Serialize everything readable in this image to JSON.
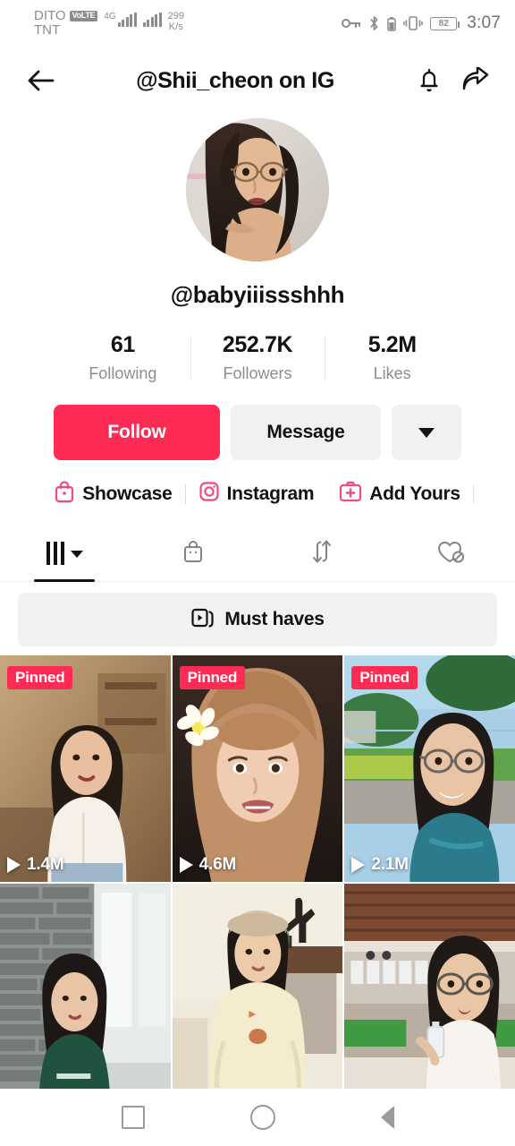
{
  "status_bar": {
    "carrier_primary": "DITO",
    "volte_badge": "VoLTE",
    "carrier_secondary": "TNT",
    "network_type": "4G",
    "net_speed_value": "299",
    "net_speed_unit": "K/s",
    "battery_percent": "82",
    "time": "3:07",
    "icons": [
      "key-icon",
      "bluetooth-icon",
      "vibrate-icon",
      "battery-icon"
    ]
  },
  "header": {
    "title": "@Shii_cheon on IG",
    "back_icon": "back-arrow-icon",
    "bell_icon": "bell-icon",
    "share_icon": "share-arrow-icon"
  },
  "profile": {
    "handle": "@babyiiissshhh",
    "avatar_alt": "profile-photo",
    "stats": [
      {
        "value": "61",
        "label": "Following"
      },
      {
        "value": "252.7K",
        "label": "Followers"
      },
      {
        "value": "5.2M",
        "label": "Likes"
      }
    ]
  },
  "actions": {
    "follow_label": "Follow",
    "message_label": "Message",
    "more_icon": "chevron-down-icon"
  },
  "links": [
    {
      "label": "Showcase",
      "icon": "shopping-bag-icon"
    },
    {
      "label": "Instagram",
      "icon": "instagram-icon"
    },
    {
      "label": "Add Yours",
      "icon": "add-photo-icon"
    }
  ],
  "tabs": [
    {
      "name": "videos",
      "icon": "grid-bars-icon",
      "active": true,
      "has_caret": true
    },
    {
      "name": "shop",
      "icon": "shopping-bag-icon",
      "active": false,
      "has_caret": false
    },
    {
      "name": "reposts",
      "icon": "repost-arrows-icon",
      "active": false,
      "has_caret": false
    },
    {
      "name": "liked",
      "icon": "heart-hidden-icon",
      "active": false,
      "has_caret": false
    }
  ],
  "playlist": {
    "label": "Must haves",
    "icon": "video-stack-icon"
  },
  "videos": [
    {
      "badge": "Pinned",
      "views": "1.4M",
      "tone_a": "#c8a97e",
      "tone_b": "#7d5c3c"
    },
    {
      "badge": "Pinned",
      "views": "4.6M",
      "tone_a": "#caa184",
      "tone_b": "#3a2a22"
    },
    {
      "badge": "Pinned",
      "views": "2.1M",
      "tone_a": "#9fc6dd",
      "tone_b": "#3f6f4c"
    },
    {
      "badge": "",
      "views": "",
      "tone_a": "#9aa3a0",
      "tone_b": "#2f4b3c"
    },
    {
      "badge": "",
      "views": "",
      "tone_a": "#efe6cd",
      "tone_b": "#6d5b44"
    },
    {
      "badge": "",
      "views": "",
      "tone_a": "#c9b8a5",
      "tone_b": "#6b4a38"
    }
  ],
  "navbar": {
    "recents_icon": "square-icon",
    "home_icon": "circle-icon",
    "back_icon": "triangle-back-icon"
  },
  "colors": {
    "accent_red": "#FE2C55",
    "pink_icon": "#EE4C7C",
    "text_primary": "#121212",
    "text_muted": "#8d8d8f",
    "chip_bg": "#f1f1f2"
  }
}
